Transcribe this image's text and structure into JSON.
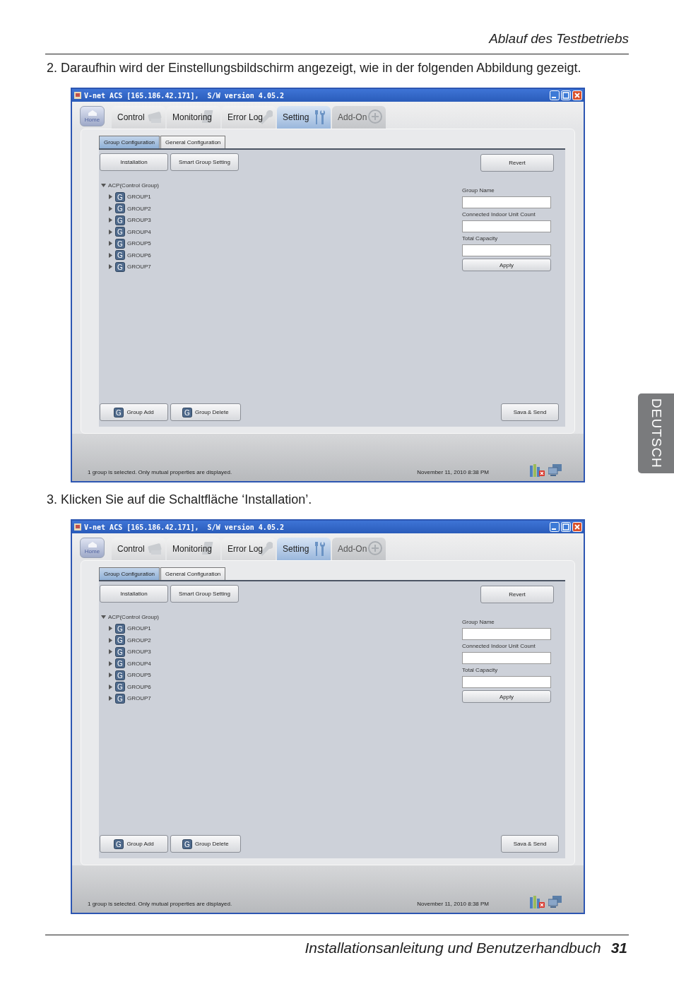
{
  "header": {
    "title": "Ablauf des Testbetriebs"
  },
  "steps": [
    {
      "text": "2. Daraufhin wird der Einstellungsbildschirm angezeigt, wie in der folgenden Abbildung gezeigt.",
      "screenshot": {
        "window_title": "V-net ACS [165.186.42.171],  S/W version 4.05.2",
        "home": "Home",
        "tabs": [
          {
            "label": "Control",
            "selected": false,
            "disabled": false
          },
          {
            "label": "Monitoring",
            "selected": false,
            "disabled": false
          },
          {
            "label": "Error Log",
            "selected": false,
            "disabled": false
          },
          {
            "label": "Setting",
            "selected": true,
            "disabled": false
          },
          {
            "label": "Add-On",
            "selected": false,
            "disabled": true
          }
        ],
        "subtabs": [
          {
            "label": "Group Configuration",
            "selected": true
          },
          {
            "label": "General Configuration",
            "selected": false
          }
        ],
        "top_buttons": [
          "Installation",
          "Smart Group Setting"
        ],
        "revert": "Revert",
        "tree": {
          "label": "ACP(Control Group)",
          "expanded": true,
          "children": [
            {
              "badge": "G",
              "label": "GROUP1",
              "expanded": false
            },
            {
              "badge": "G",
              "label": "GROUP2",
              "expanded": false
            },
            {
              "badge": "G",
              "label": "GROUP3",
              "expanded": false
            },
            {
              "badge": "G",
              "label": "GROUP4",
              "expanded": false
            },
            {
              "badge": "G",
              "label": "GROUP5",
              "expanded": false
            },
            {
              "badge": "G",
              "label": "GROUP6",
              "expanded": false
            },
            {
              "badge": "G",
              "label": "GROUP7",
              "expanded": false
            }
          ]
        },
        "fields": [
          {
            "label": "Group Name"
          },
          {
            "label": "Connected Indoor Unit Count"
          },
          {
            "label": "Total Capacity"
          }
        ],
        "apply": "Apply",
        "bottom_buttons": [
          {
            "badge": "G",
            "label": "Group Add"
          },
          {
            "badge": "G",
            "label": "Group Delete"
          }
        ],
        "save": "Sava & Send",
        "status": {
          "message": "1 group is selected. Only mutual properties are displayed.",
          "datetime": "November 11, 2010  8:38 PM"
        }
      }
    },
    {
      "text": "3. Klicken Sie auf die Schaltfläche ‘Installation’.",
      "screenshot": {
        "window_title": "V-net ACS [165.186.42.171],  S/W version 4.05.2",
        "home": "Home",
        "tabs": [
          {
            "label": "Control",
            "selected": false,
            "disabled": false
          },
          {
            "label": "Monitoring",
            "selected": false,
            "disabled": false
          },
          {
            "label": "Error Log",
            "selected": false,
            "disabled": false
          },
          {
            "label": "Setting",
            "selected": true,
            "disabled": false
          },
          {
            "label": "Add-On",
            "selected": false,
            "disabled": true
          }
        ],
        "subtabs": [
          {
            "label": "Group Configuration",
            "selected": true
          },
          {
            "label": "General Configuration",
            "selected": false
          }
        ],
        "top_buttons": [
          "Installation",
          "Smart Group Setting"
        ],
        "revert": "Revert",
        "tree": {
          "label": "ACP(Control Group)",
          "expanded": true,
          "children": [
            {
              "badge": "G",
              "label": "GROUP1",
              "expanded": false
            },
            {
              "badge": "G",
              "label": "GROUP2",
              "expanded": false
            },
            {
              "badge": "G",
              "label": "GROUP3",
              "expanded": false
            },
            {
              "badge": "G",
              "label": "GROUP4",
              "expanded": false
            },
            {
              "badge": "G",
              "label": "GROUP5",
              "expanded": false
            },
            {
              "badge": "G",
              "label": "GROUP6",
              "expanded": false
            },
            {
              "badge": "G",
              "label": "GROUP7",
              "expanded": false
            }
          ]
        },
        "fields": [
          {
            "label": "Group Name"
          },
          {
            "label": "Connected Indoor Unit Count"
          },
          {
            "label": "Total Capacity"
          }
        ],
        "apply": "Apply",
        "bottom_buttons": [
          {
            "badge": "G",
            "label": "Group Add"
          },
          {
            "badge": "G",
            "label": "Group Delete"
          }
        ],
        "save": "Sava & Send",
        "status": {
          "message": "1 group is selected. Only mutual properties are displayed.",
          "datetime": "November 11, 2010  8:38 PM"
        }
      }
    }
  ],
  "side_tab": {
    "label": "DEUTSCH"
  },
  "footer": {
    "title": "Installationsanleitung und Benutzerhandbuch",
    "page": "31"
  }
}
